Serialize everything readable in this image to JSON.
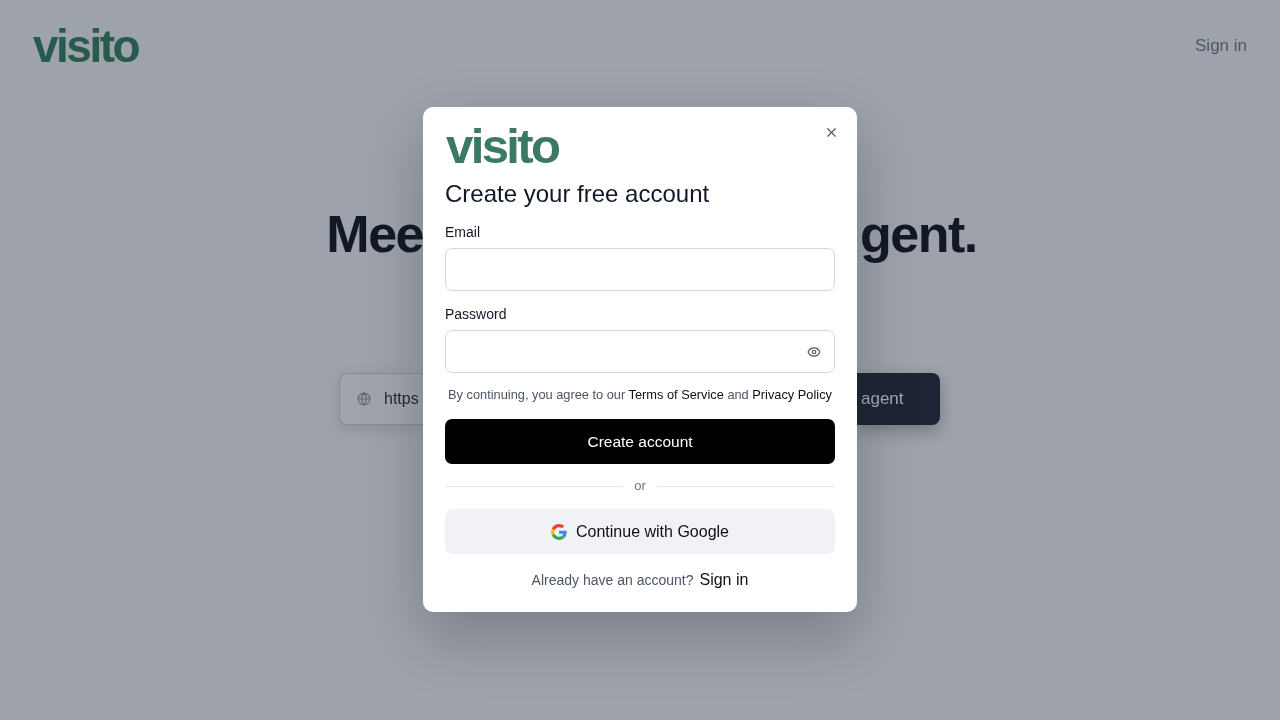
{
  "background": {
    "logo": "visito",
    "nav_link": "Sign in",
    "headline": {
      "left_fragment": "Mee",
      "right_fragment": "gent."
    },
    "url_field": {
      "value": "https"
    },
    "submit_button": {
      "label": "agent"
    }
  },
  "modal": {
    "logo": "visito",
    "title": "Create your free account",
    "fields": [
      {
        "kind": "email",
        "label": "Email"
      },
      {
        "kind": "password",
        "label": "Password"
      }
    ],
    "terms": [
      {
        "kind": "text",
        "text": "By continuing, you agree to our"
      },
      {
        "kind": "link",
        "text": "Terms of Service"
      },
      {
        "kind": "text",
        "text": "and"
      },
      {
        "kind": "link",
        "text": "Privacy Policy"
      }
    ],
    "primary_button": "Create account",
    "divider": "or",
    "google_button": "Continue with Google",
    "footer": {
      "prompt": "Already have an account?",
      "link": "Sign in"
    }
  }
}
